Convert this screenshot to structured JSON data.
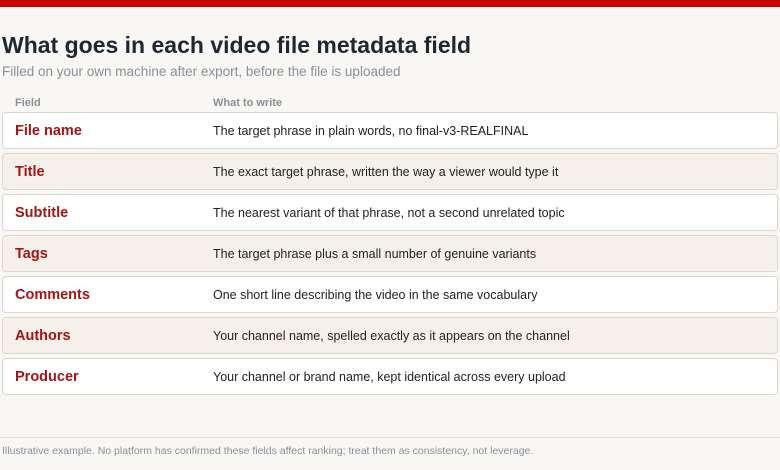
{
  "colors": {
    "accent_bar": "#cc0000",
    "field_name": "#a31515",
    "title": "#1f2733",
    "muted": "#8a8f99"
  },
  "header": {
    "title": "What goes in each video file metadata field",
    "subtitle": "Filled on your own machine after export, before the file is uploaded"
  },
  "table": {
    "columns": [
      "Field",
      "What to write"
    ],
    "rows": [
      {
        "field": "File name",
        "description": "The target phrase in plain words, no final-v3-REALFINAL"
      },
      {
        "field": "Title",
        "description": "The exact target phrase, written the way a viewer would type it"
      },
      {
        "field": "Subtitle",
        "description": "The nearest variant of that phrase, not a second unrelated topic"
      },
      {
        "field": "Tags",
        "description": "The target phrase plus a small number of genuine variants"
      },
      {
        "field": "Comments",
        "description": "One short line describing the video in the same vocabulary"
      },
      {
        "field": "Authors",
        "description": "Your channel name, spelled exactly as it appears on the channel"
      },
      {
        "field": "Producer",
        "description": "Your channel or brand name, kept identical across every upload"
      }
    ]
  },
  "footer": {
    "note": "Illustrative example. No platform has confirmed these fields affect ranking; treat them as consistency, not leverage."
  }
}
